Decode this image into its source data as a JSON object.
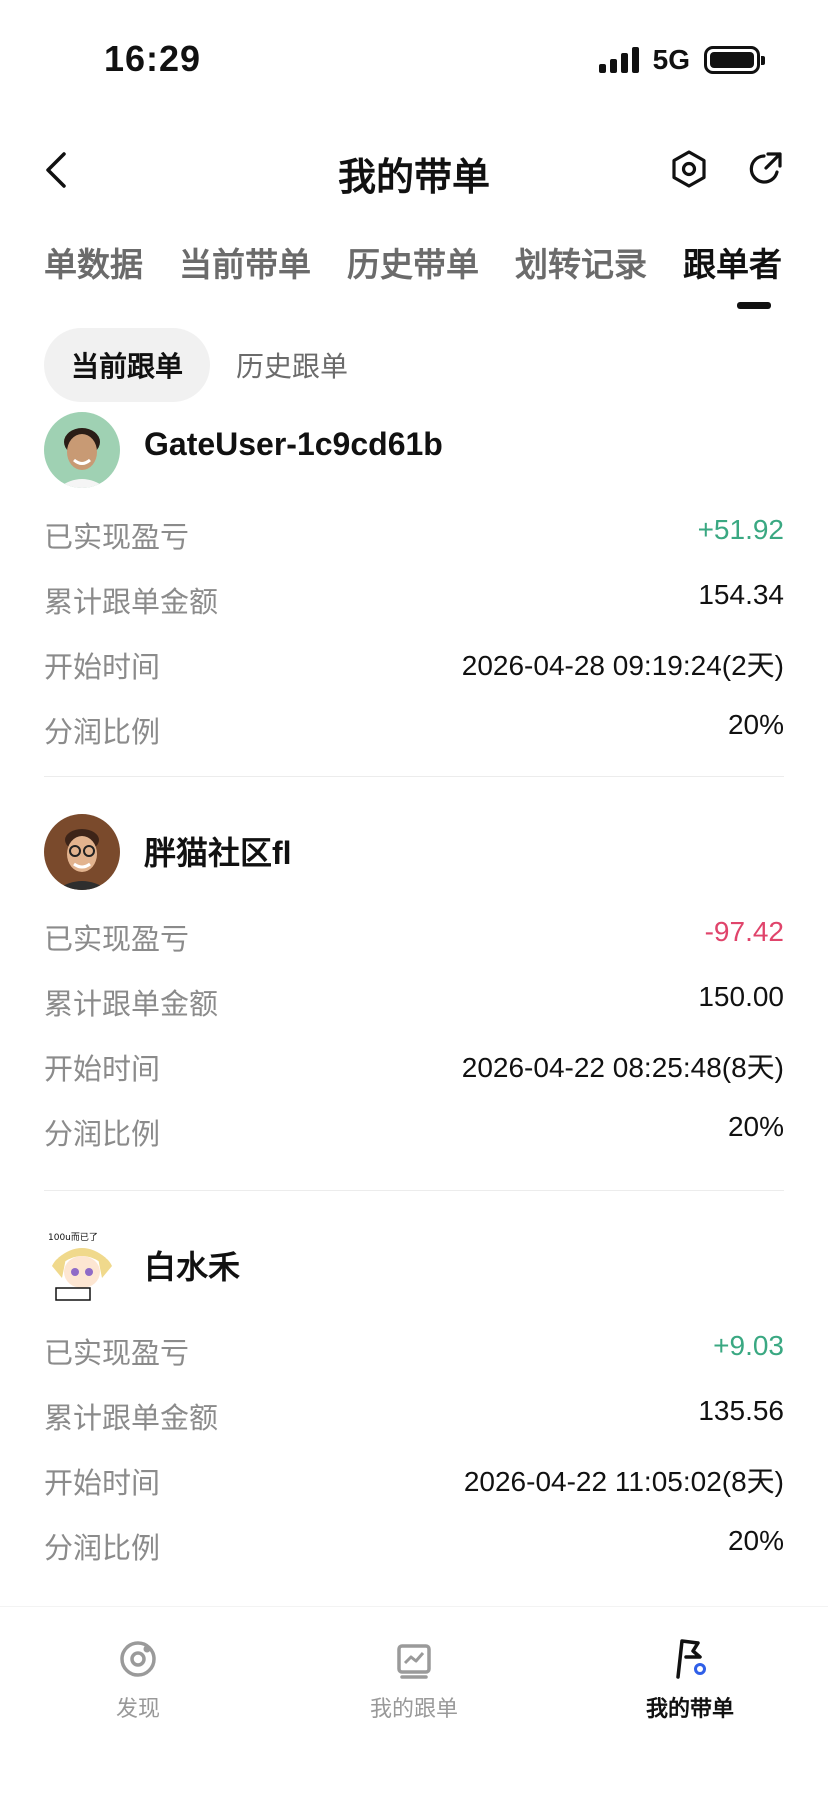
{
  "status": {
    "time": "16:29",
    "network": "5G"
  },
  "header": {
    "title": "我的带单"
  },
  "tabs": [
    {
      "label": "单数据"
    },
    {
      "label": "当前带单"
    },
    {
      "label": "历史带单"
    },
    {
      "label": "划转记录"
    },
    {
      "label": "跟单者"
    }
  ],
  "subtabs": {
    "active": "当前跟单",
    "other": "历史跟单"
  },
  "followers": [
    {
      "name": "GateUser-1c9cd61b",
      "realized_pnl_label": "已实现盈亏",
      "realized_pnl": "+51.92",
      "total_amount_label": "累计跟单金额",
      "total_amount": "154.34",
      "start_time_label": "开始时间",
      "start_time": "2026-04-28 09:19:24(2天)",
      "profit_share_label": "分润比例",
      "profit_share": "20%"
    },
    {
      "name": "胖猫社区fl",
      "realized_pnl_label": "已实现盈亏",
      "realized_pnl": "-97.42",
      "total_amount_label": "累计跟单金额",
      "total_amount": "150.00",
      "start_time_label": "开始时间",
      "start_time": "2026-04-22 08:25:48(8天)",
      "profit_share_label": "分润比例",
      "profit_share": "20%"
    },
    {
      "name": "白水禾",
      "avatar_text": "100u而已了",
      "realized_pnl_label": "已实现盈亏",
      "realized_pnl": "+9.03",
      "total_amount_label": "累计跟单金额",
      "total_amount": "135.56",
      "start_time_label": "开始时间",
      "start_time": "2026-04-22 11:05:02(8天)",
      "profit_share_label": "分润比例",
      "profit_share": "20%"
    }
  ],
  "bottom_nav": [
    {
      "label": "发现",
      "icon": "discover-icon"
    },
    {
      "label": "我的跟单",
      "icon": "chart-icon"
    },
    {
      "label": "我的带单",
      "icon": "flag-icon"
    }
  ],
  "colors": {
    "positive": "#3aa882",
    "negative": "#e0446b",
    "muted": "#8b8b8b"
  }
}
